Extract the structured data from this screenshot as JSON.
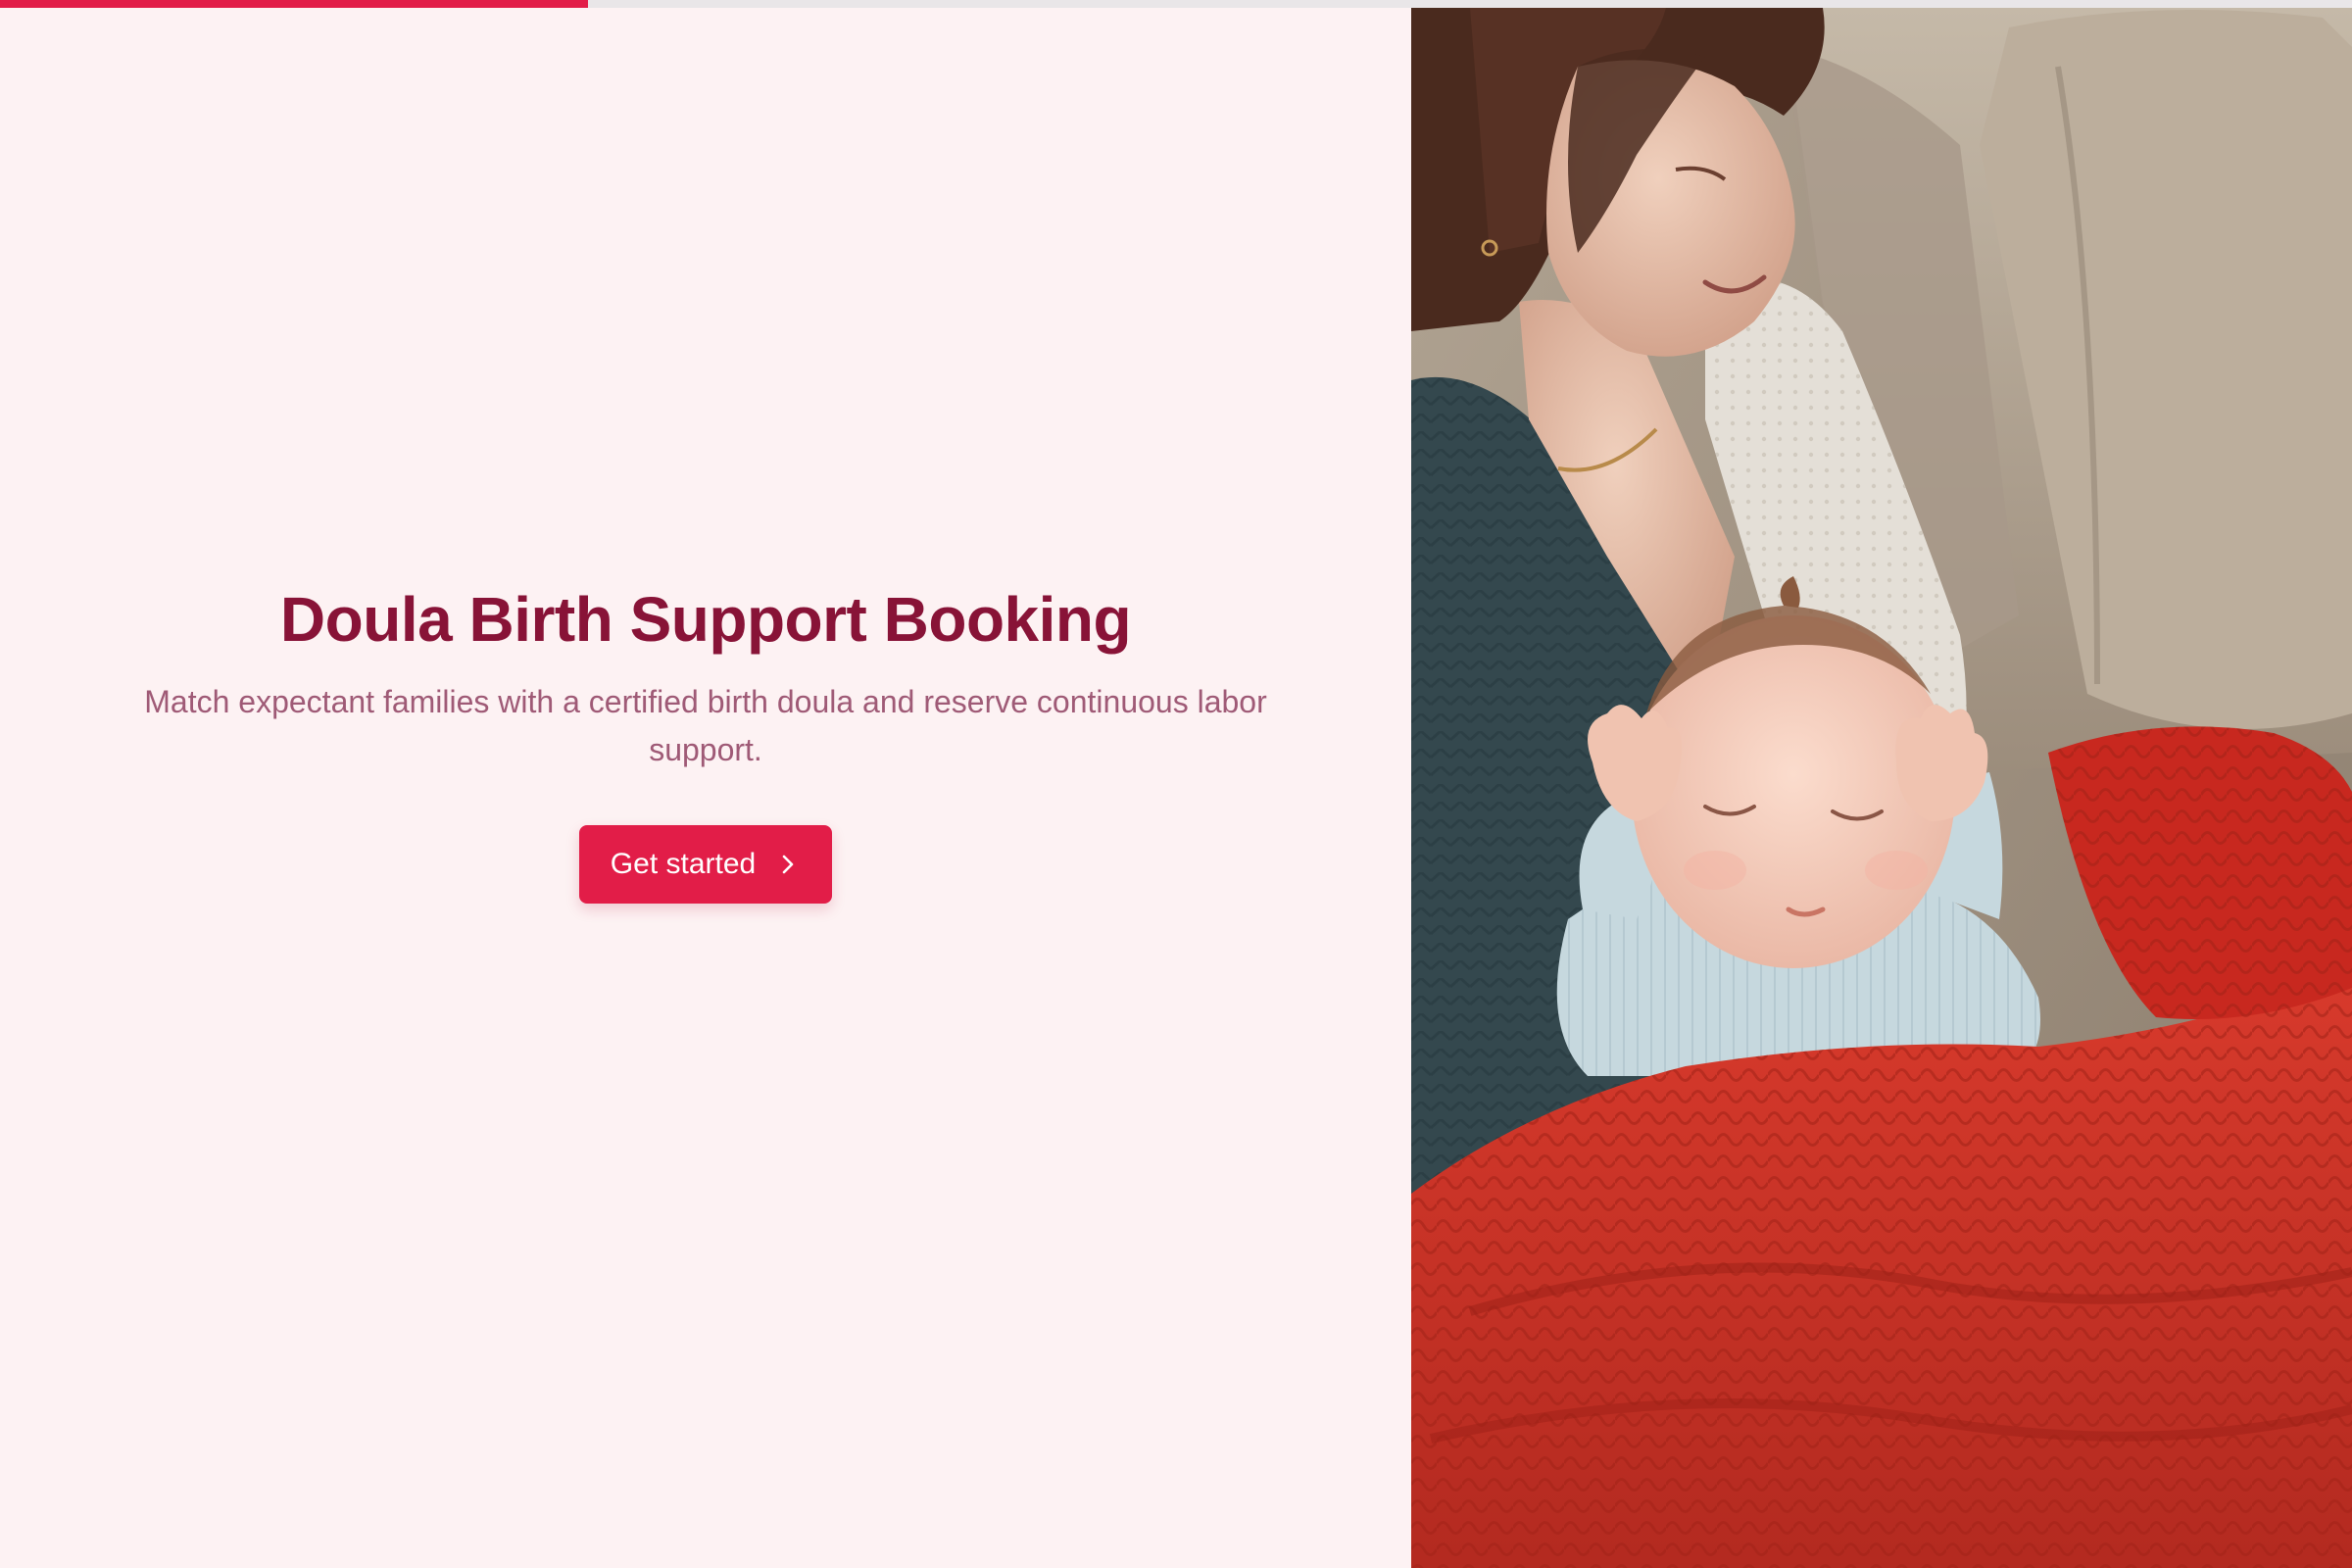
{
  "progress": {
    "fraction": 0.25,
    "color": "#e21d48"
  },
  "hero": {
    "title": "Doula Birth Support Booking",
    "subtitle": "Match expectant families with a certified birth doula and reserve continuous labor support.",
    "cta_label": "Get started",
    "cta_icon": "chevron-right-icon"
  },
  "photo": {
    "subject": "mother-holding-sleeping-newborn-under-red-knit-blanket"
  },
  "colors": {
    "accent": "#e21d48",
    "title": "#881337",
    "subtitle": "#9f5a76",
    "background": "#fdf2f3"
  }
}
